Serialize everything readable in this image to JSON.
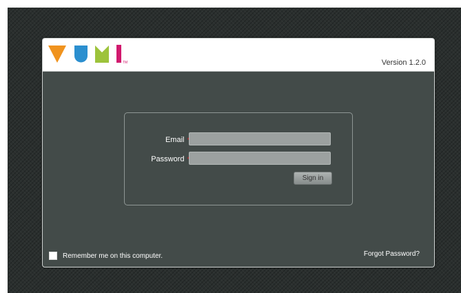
{
  "header": {
    "logo_alt": "VUMI",
    "trademark": "TM",
    "version_text": "Version 1.2.0"
  },
  "login": {
    "email_label": "Email",
    "password_label": "Password",
    "required_marker": "*",
    "email_value": "",
    "password_value": "",
    "signin_label": "Sign in"
  },
  "footer": {
    "remember_label": "Remember me on this computer.",
    "remember_checked": false,
    "forgot_label": "Forgot Password?"
  },
  "colors": {
    "logo_orange": "#f0931e",
    "logo_blue": "#2b8fcf",
    "logo_green": "#9dc33b",
    "logo_magenta": "#d1196e",
    "panel": "#434b49",
    "required": "#c9272d"
  }
}
